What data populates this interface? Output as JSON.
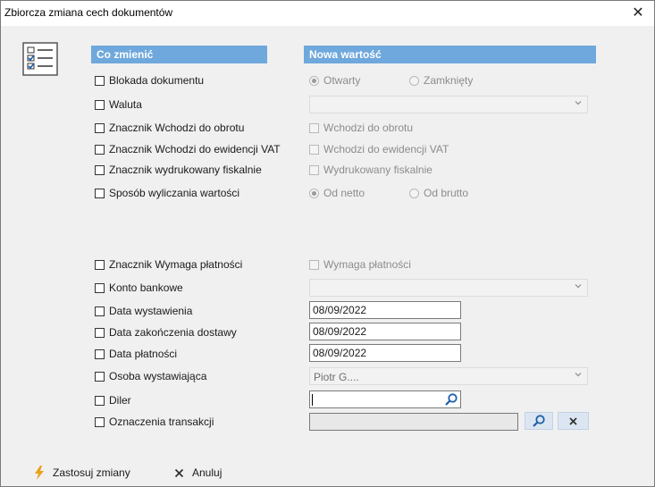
{
  "window": {
    "title": "Zbiorcza zmiana cech dokumentów",
    "close_glyph": "✕"
  },
  "headers": {
    "what": "Co zmienić",
    "new_value": "Nowa wartość"
  },
  "fields": {
    "blokada": "Blokada dokumentu",
    "waluta": "Waluta",
    "wchodzi_obrotu": "Znacznik Wchodzi do obrotu",
    "wchodzi_vat": "Znacznik Wchodzi do ewidencji VAT",
    "fiskalnie": "Znacznik wydrukowany fiskalnie",
    "sposob": "Sposób wyliczania wartości",
    "wymaga": "Znacznik Wymaga płatności",
    "konto": "Konto bankowe",
    "data_wyst": "Data wystawienia",
    "data_zak": "Data zakończenia dostawy",
    "data_plat": "Data płatności",
    "osoba": "Osoba wystawiająca",
    "diler": "Diler",
    "oznaczenia": "Oznaczenia transakcji"
  },
  "values": {
    "otwarty": "Otwarty",
    "zamkniety": "Zamknięty",
    "wchodzi_obrotu": "Wchodzi do obrotu",
    "wchodzi_vat": "Wchodzi do ewidencji VAT",
    "fiskalnie": "Wydrukowany fiskalnie",
    "od_netto": "Od netto",
    "od_brutto": "Od brutto",
    "wymaga": "Wymaga płatności",
    "data_wyst": "08/09/2022",
    "data_zak": "08/09/2022",
    "data_plat": "08/09/2022",
    "osoba": "Piotr G...."
  },
  "buttons": {
    "apply": "Zastosuj zmiany",
    "cancel": "Anuluj"
  },
  "colors": {
    "header_bg": "#6fa8dc",
    "accent_search": "#1f5fa8",
    "apply_icon": "#e8a21a"
  }
}
